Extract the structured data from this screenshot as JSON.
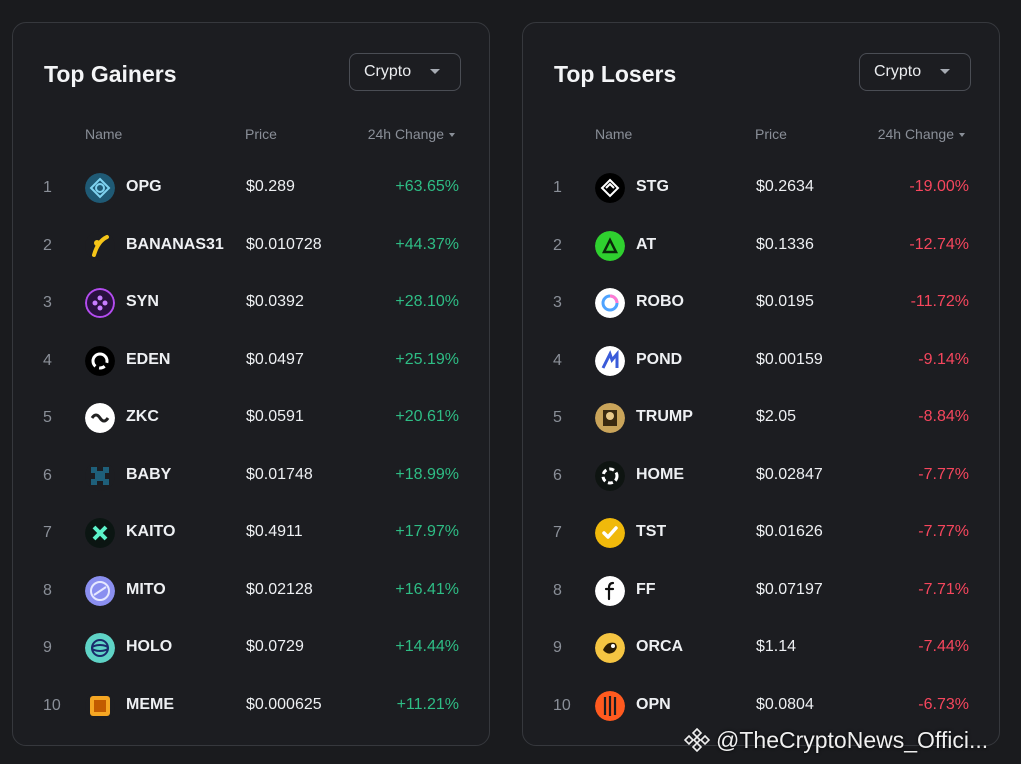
{
  "gainers": {
    "title": "Top Gainers",
    "filter": "Crypto",
    "headers": {
      "name": "Name",
      "price": "Price",
      "change": "24h Change"
    },
    "rows": [
      {
        "rank": "1",
        "name": "OPG",
        "price": "$0.289",
        "change": "+63.65%"
      },
      {
        "rank": "2",
        "name": "BANANAS31",
        "price": "$0.010728",
        "change": "+44.37%"
      },
      {
        "rank": "3",
        "name": "SYN",
        "price": "$0.0392",
        "change": "+28.10%"
      },
      {
        "rank": "4",
        "name": "EDEN",
        "price": "$0.0497",
        "change": "+25.19%"
      },
      {
        "rank": "5",
        "name": "ZKC",
        "price": "$0.0591",
        "change": "+20.61%"
      },
      {
        "rank": "6",
        "name": "BABY",
        "price": "$0.01748",
        "change": "+18.99%"
      },
      {
        "rank": "7",
        "name": "KAITO",
        "price": "$0.4911",
        "change": "+17.97%"
      },
      {
        "rank": "8",
        "name": "MITO",
        "price": "$0.02128",
        "change": "+16.41%"
      },
      {
        "rank": "9",
        "name": "HOLO",
        "price": "$0.0729",
        "change": "+14.44%"
      },
      {
        "rank": "10",
        "name": "MEME",
        "price": "$0.000625",
        "change": "+11.21%"
      }
    ]
  },
  "losers": {
    "title": "Top Losers",
    "filter": "Crypto",
    "headers": {
      "name": "Name",
      "price": "Price",
      "change": "24h Change"
    },
    "rows": [
      {
        "rank": "1",
        "name": "STG",
        "price": "$0.2634",
        "change": "-19.00%"
      },
      {
        "rank": "2",
        "name": "AT",
        "price": "$0.1336",
        "change": "-12.74%"
      },
      {
        "rank": "3",
        "name": "ROBO",
        "price": "$0.0195",
        "change": "-11.72%"
      },
      {
        "rank": "4",
        "name": "POND",
        "price": "$0.00159",
        "change": "-9.14%"
      },
      {
        "rank": "5",
        "name": "TRUMP",
        "price": "$2.05",
        "change": "-8.84%"
      },
      {
        "rank": "6",
        "name": "HOME",
        "price": "$0.02847",
        "change": "-7.77%"
      },
      {
        "rank": "7",
        "name": "TST",
        "price": "$0.01626",
        "change": "-7.77%"
      },
      {
        "rank": "8",
        "name": "FF",
        "price": "$0.07197",
        "change": "-7.71%"
      },
      {
        "rank": "9",
        "name": "ORCA",
        "price": "$1.14",
        "change": "-7.44%"
      },
      {
        "rank": "10",
        "name": "OPN",
        "price": "$0.0804",
        "change": "-6.73%"
      }
    ]
  },
  "icons": {
    "dropdown": "chevron-down-icon",
    "sort": "sort-desc-icon",
    "watermark": "binance-logo-icon"
  },
  "colors": {
    "positive": "#2ebd85",
    "negative": "#f6465d",
    "background": "#1a1b1e"
  },
  "watermark": {
    "text": "@TheCryptoNews_Offici..."
  }
}
